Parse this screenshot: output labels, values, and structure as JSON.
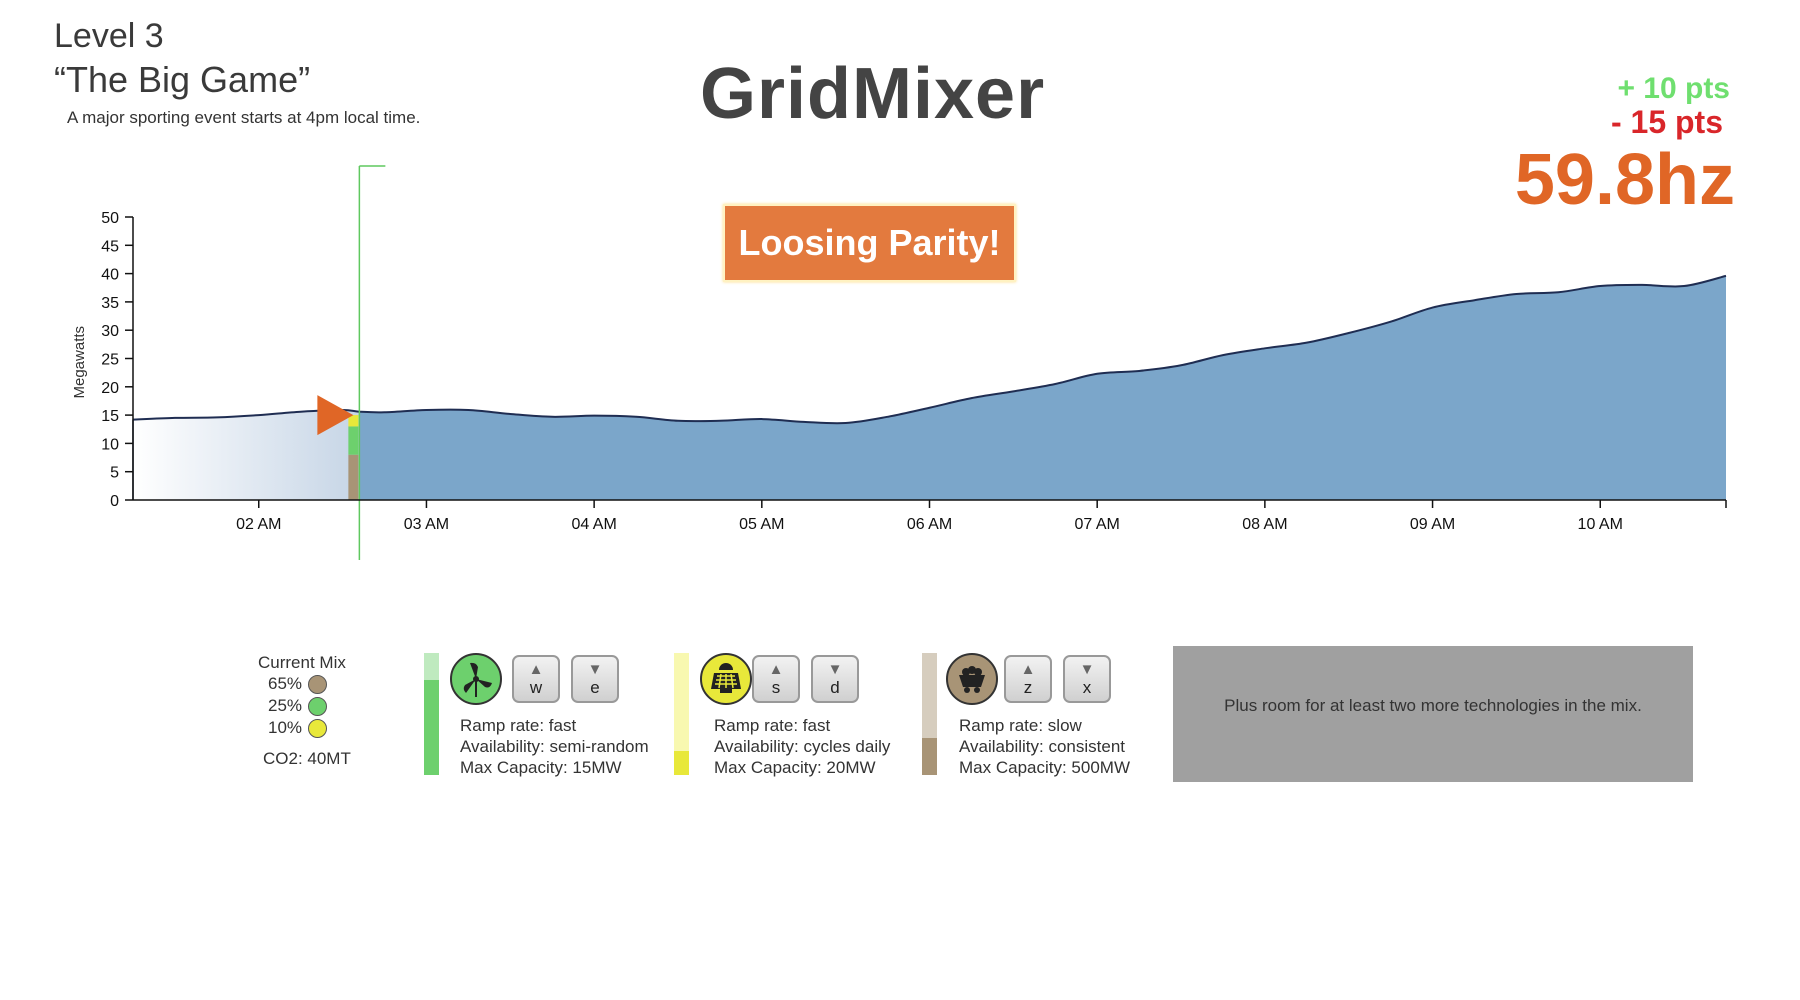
{
  "header": {
    "level": "Level 3",
    "subtitle": "“The Big Game”",
    "description": "A major sporting event starts at 4pm local time.",
    "title": "GridMixer"
  },
  "score": {
    "plus": "+ 10 pts",
    "minus": "- 15 pts",
    "frequency": "59.8hz"
  },
  "alert": "Loosing Parity!",
  "colors": {
    "area": "#7ba6ca",
    "line": "#1f2d52",
    "marker": "#e06626",
    "cursor": "#5fc85f",
    "plus": "#6fdf6f",
    "minus": "#d9262a",
    "frequency": "#e06626",
    "wind": "#6dd06d",
    "solar": "#e8e83a",
    "coal": "#a89476"
  },
  "chart_data": {
    "type": "area",
    "ylabel": "Megawatts",
    "ylim": [
      0,
      50
    ],
    "y_ticks": [
      "0",
      "5",
      "10",
      "15",
      "20",
      "25",
      "30",
      "35",
      "40",
      "45",
      "50"
    ],
    "x_tick_labels": [
      "02 AM",
      "03 AM",
      "04 AM",
      "05 AM",
      "06 AM",
      "07 AM",
      "08 AM",
      "09 AM",
      "10 AM"
    ],
    "x_hours": [
      1.25,
      1.5,
      1.75,
      2.0,
      2.25,
      2.5,
      2.6,
      2.75,
      3.0,
      3.25,
      3.5,
      3.75,
      4.0,
      4.25,
      4.5,
      4.75,
      5.0,
      5.25,
      5.5,
      5.75,
      6.0,
      6.25,
      6.5,
      6.75,
      7.0,
      7.25,
      7.5,
      7.75,
      8.0,
      8.25,
      8.5,
      8.75,
      9.0,
      9.25,
      9.5,
      9.75,
      10.0,
      10.25,
      10.5,
      10.75
    ],
    "values": [
      14.2,
      14.5,
      14.6,
      15.0,
      15.6,
      15.9,
      15.6,
      15.5,
      15.9,
      15.9,
      15.2,
      14.7,
      14.9,
      14.7,
      14.0,
      14.0,
      14.3,
      13.8,
      13.6,
      14.7,
      16.3,
      18.0,
      19.2,
      20.5,
      22.3,
      22.8,
      23.8,
      25.6,
      26.8,
      27.8,
      29.5,
      31.5,
      34.0,
      35.3,
      36.4,
      36.7,
      37.8,
      38.0,
      37.8,
      39.6
    ],
    "current_time_hour": 2.6,
    "current_supply": {
      "coal_mw": 8,
      "wind_mw": 5,
      "solar_mw": 2
    }
  },
  "mix": {
    "title": "Current Mix",
    "items": [
      {
        "percent": "65%",
        "color": "#a89476"
      },
      {
        "percent": "25%",
        "color": "#6dd06d"
      },
      {
        "percent": "10%",
        "color": "#e8e83a"
      }
    ],
    "co2": "CO2: 40MT"
  },
  "technologies": [
    {
      "name": "wind",
      "level": 0.78,
      "up_key": "w",
      "down_key": "e",
      "ramp": "Ramp rate: fast",
      "availability": "Availability: semi-random",
      "capacity": "Max Capacity: 15MW"
    },
    {
      "name": "solar",
      "level": 0.2,
      "up_key": "s",
      "down_key": "d",
      "ramp": "Ramp rate: fast",
      "availability": "Availability: cycles daily",
      "capacity": "Max Capacity: 20MW"
    },
    {
      "name": "coal",
      "level": 0.3,
      "up_key": "z",
      "down_key": "x",
      "ramp": "Ramp rate: slow",
      "availability": "Availability: consistent",
      "capacity": "Max Capacity: 500MW"
    }
  ],
  "more_tech": "Plus room for at least two more technologies in the mix.",
  "icons": {
    "up": "▲",
    "down": "▼",
    "wind": "wind-turbine-icon",
    "solar": "solar-panel-icon",
    "coal": "coal-cart-icon"
  }
}
